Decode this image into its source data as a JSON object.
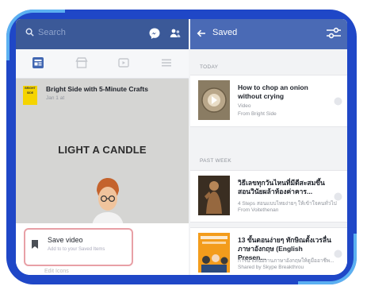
{
  "left_pane": {
    "search_placeholder": "Search",
    "post": {
      "page_name": "Bright Side with 5-Minute Crafts",
      "avatar_text": "BRIGHT SIDE",
      "timestamp": "Jan 1 at",
      "video_caption": "LIGHT A CANDLE"
    },
    "save_sheet": {
      "save_label": "Save video",
      "save_sublabel": "Add to to your Saved Items",
      "next_item_label": "Edit Icons"
    }
  },
  "right_pane": {
    "title": "Saved",
    "sections": [
      {
        "label": "TODAY",
        "items": [
          {
            "title": "How to chop an onion without crying",
            "meta1": "Video",
            "meta2": "From Bright Side"
          }
        ]
      },
      {
        "label": "PAST WEEK",
        "items": [
          {
            "title": "วิธีเลขทุกวันไหนที่มีดีสะสมขึ้น สอนวินัยผล้าห้องค่าคาร...",
            "meta1": "4 Steps สอนแบบไทยง่ายๆ ให้เข้าใจคนทั่วไป",
            "meta2": "From Voitethenan"
          },
          {
            "title": "13 ขั้นตอนง่ายๆ ทักษิณตั้งเวรลื่น ภาษาอังกฤษ (English Presen...",
            "meta1": "การนำเสนองานภาษาอังกฤษให้ดูมืออาชีพ...",
            "meta2": "Shared by Skype Breakthrou"
          }
        ]
      }
    ]
  },
  "colors": {
    "frame": "#1f47c7",
    "left_topbar": "#3b5998",
    "right_topbar": "#4a6ab5",
    "highlight_border": "#e8a0a6"
  },
  "icons": [
    "search-icon",
    "messenger-icon",
    "people-icon",
    "news-feed-icon",
    "marketplace-icon",
    "watch-icon",
    "menu-icon",
    "bookmark-icon",
    "back-arrow-icon",
    "filter-icon",
    "more-options-icon"
  ]
}
